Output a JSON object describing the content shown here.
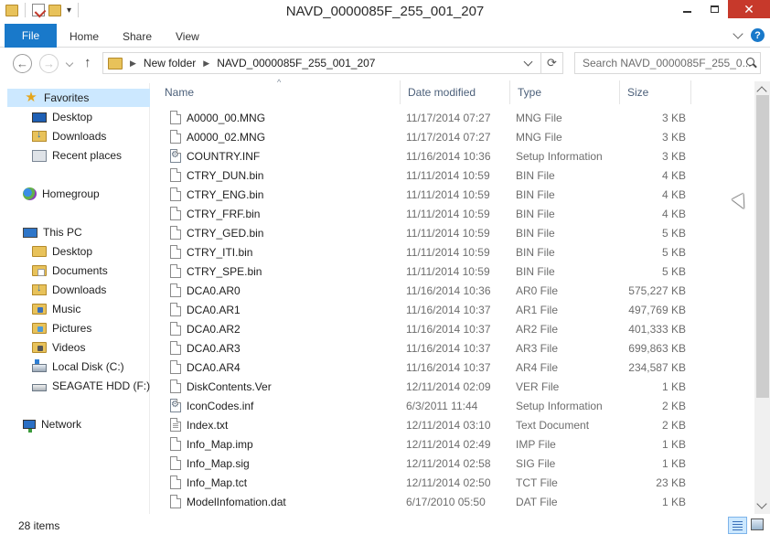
{
  "window": {
    "title": "NAVD_0000085F_255_001_207"
  },
  "ribbon": {
    "file": "File",
    "tabs": [
      "Home",
      "Share",
      "View"
    ]
  },
  "address": {
    "crumbs": [
      "New folder",
      "NAVD_0000085F_255_001_207"
    ]
  },
  "search": {
    "placeholder": "Search NAVD_0000085F_255_0..."
  },
  "nav_pane": {
    "favorites": "Favorites",
    "desktop": "Desktop",
    "downloads": "Downloads",
    "recent": "Recent places",
    "homegroup": "Homegroup",
    "this_pc": "This PC",
    "pc_desktop": "Desktop",
    "pc_documents": "Documents",
    "pc_downloads": "Downloads",
    "pc_music": "Music",
    "pc_pictures": "Pictures",
    "pc_videos": "Videos",
    "local_disk": "Local Disk (C:)",
    "seagate": "SEAGATE HDD (F:)",
    "network": "Network"
  },
  "columns": {
    "name": "Name",
    "date": "Date modified",
    "type": "Type",
    "size": "Size"
  },
  "files": [
    {
      "name": "A0000_00.MNG",
      "date": "11/17/2014 07:27",
      "type": "MNG File",
      "size": "3 KB",
      "icon": "file-icon"
    },
    {
      "name": "A0000_02.MNG",
      "date": "11/17/2014 07:27",
      "type": "MNG File",
      "size": "3 KB",
      "icon": "file-icon"
    },
    {
      "name": "COUNTRY.INF",
      "date": "11/16/2014 10:36",
      "type": "Setup Information",
      "size": "3 KB",
      "icon": "settings-file-icon"
    },
    {
      "name": "CTRY_DUN.bin",
      "date": "11/11/2014 10:59",
      "type": "BIN File",
      "size": "4 KB",
      "icon": "file-icon"
    },
    {
      "name": "CTRY_ENG.bin",
      "date": "11/11/2014 10:59",
      "type": "BIN File",
      "size": "4 KB",
      "icon": "file-icon"
    },
    {
      "name": "CTRY_FRF.bin",
      "date": "11/11/2014 10:59",
      "type": "BIN File",
      "size": "4 KB",
      "icon": "file-icon"
    },
    {
      "name": "CTRY_GED.bin",
      "date": "11/11/2014 10:59",
      "type": "BIN File",
      "size": "5 KB",
      "icon": "file-icon"
    },
    {
      "name": "CTRY_ITI.bin",
      "date": "11/11/2014 10:59",
      "type": "BIN File",
      "size": "5 KB",
      "icon": "file-icon"
    },
    {
      "name": "CTRY_SPE.bin",
      "date": "11/11/2014 10:59",
      "type": "BIN File",
      "size": "5 KB",
      "icon": "file-icon"
    },
    {
      "name": "DCA0.AR0",
      "date": "11/16/2014 10:36",
      "type": "AR0 File",
      "size": "575,227 KB",
      "icon": "file-icon"
    },
    {
      "name": "DCA0.AR1",
      "date": "11/16/2014 10:37",
      "type": "AR1 File",
      "size": "497,769 KB",
      "icon": "file-icon"
    },
    {
      "name": "DCA0.AR2",
      "date": "11/16/2014 10:37",
      "type": "AR2 File",
      "size": "401,333 KB",
      "icon": "file-icon"
    },
    {
      "name": "DCA0.AR3",
      "date": "11/16/2014 10:37",
      "type": "AR3 File",
      "size": "699,863 KB",
      "icon": "file-icon"
    },
    {
      "name": "DCA0.AR4",
      "date": "11/16/2014 10:37",
      "type": "AR4 File",
      "size": "234,587 KB",
      "icon": "file-icon"
    },
    {
      "name": "DiskContents.Ver",
      "date": "12/11/2014 02:09",
      "type": "VER File",
      "size": "1 KB",
      "icon": "file-icon"
    },
    {
      "name": "IconCodes.inf",
      "date": "6/3/2011 11:44",
      "type": "Setup Information",
      "size": "2 KB",
      "icon": "settings-file-icon"
    },
    {
      "name": "Index.txt",
      "date": "12/11/2014 03:10",
      "type": "Text Document",
      "size": "2 KB",
      "icon": "text-file-icon"
    },
    {
      "name": "Info_Map.imp",
      "date": "12/11/2014 02:49",
      "type": "IMP File",
      "size": "1 KB",
      "icon": "file-icon"
    },
    {
      "name": "Info_Map.sig",
      "date": "12/11/2014 02:58",
      "type": "SIG File",
      "size": "1 KB",
      "icon": "file-icon"
    },
    {
      "name": "Info_Map.tct",
      "date": "12/11/2014 02:50",
      "type": "TCT File",
      "size": "23 KB",
      "icon": "file-icon"
    },
    {
      "name": "ModelInfomation.dat",
      "date": "6/17/2010 05:50",
      "type": "DAT File",
      "size": "1 KB",
      "icon": "file-icon"
    }
  ],
  "status": {
    "item_count": "28 items"
  },
  "colors": {
    "accent": "#1979ca",
    "selection": "#cce8ff",
    "header_text": "#4c607a",
    "close_button": "#c7392b"
  }
}
